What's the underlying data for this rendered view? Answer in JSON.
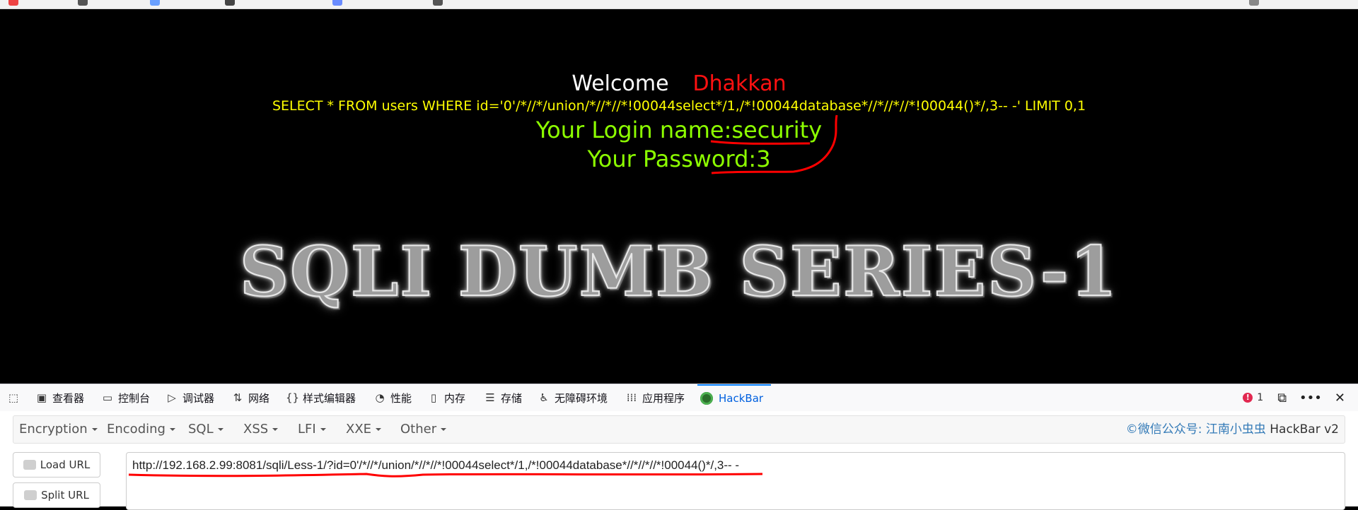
{
  "page": {
    "welcome": "Welcome",
    "user": "Dhakkan",
    "query": "SELECT * FROM users WHERE id='0'/*//*/union/*//*//*!00044select*/1,/*!00044database*//*//*//*!00044()*/,3-- -' LIMIT 0,1",
    "login": "Your Login name:security",
    "password": "Your Password:3",
    "banner": "SQLI DUMB SERIES-1"
  },
  "devtools": {
    "tabs": [
      {
        "label": "查看器",
        "icon": "inspector-icon"
      },
      {
        "label": "控制台",
        "icon": "console-icon"
      },
      {
        "label": "调试器",
        "icon": "debugger-icon"
      },
      {
        "label": "网络",
        "icon": "network-icon"
      },
      {
        "label": "样式编辑器",
        "icon": "style-editor-icon"
      },
      {
        "label": "性能",
        "icon": "performance-icon"
      },
      {
        "label": "内存",
        "icon": "memory-icon"
      },
      {
        "label": "存储",
        "icon": "storage-icon"
      },
      {
        "label": "无障碍环境",
        "icon": "accessibility-icon"
      },
      {
        "label": "应用程序",
        "icon": "application-icon"
      },
      {
        "label": "HackBar",
        "icon": "hackbar-icon"
      }
    ],
    "error_count": "1"
  },
  "hackbar": {
    "menu": [
      "Encryption",
      "Encoding",
      "SQL",
      "XSS",
      "LFI",
      "XXE",
      "Other"
    ],
    "credit_prefix": "©微信公众号: ",
    "credit_name": "江南小虫虫",
    "credit_suffix": " HackBar v2",
    "load_url": "Load URL",
    "split_url": "Split URL",
    "url": "http://192.168.2.99:8081/sqli/Less-1/?id=0'/*//*/union/*//*//*!00044select*/1,/*!00044database*//*//*//*!00044()*/,3-- -"
  },
  "colors": {
    "query": "#ffff00",
    "login": "#8dff00",
    "user": "#ff1111",
    "annotation": "#ff0000",
    "active_tab": "#0060df"
  }
}
